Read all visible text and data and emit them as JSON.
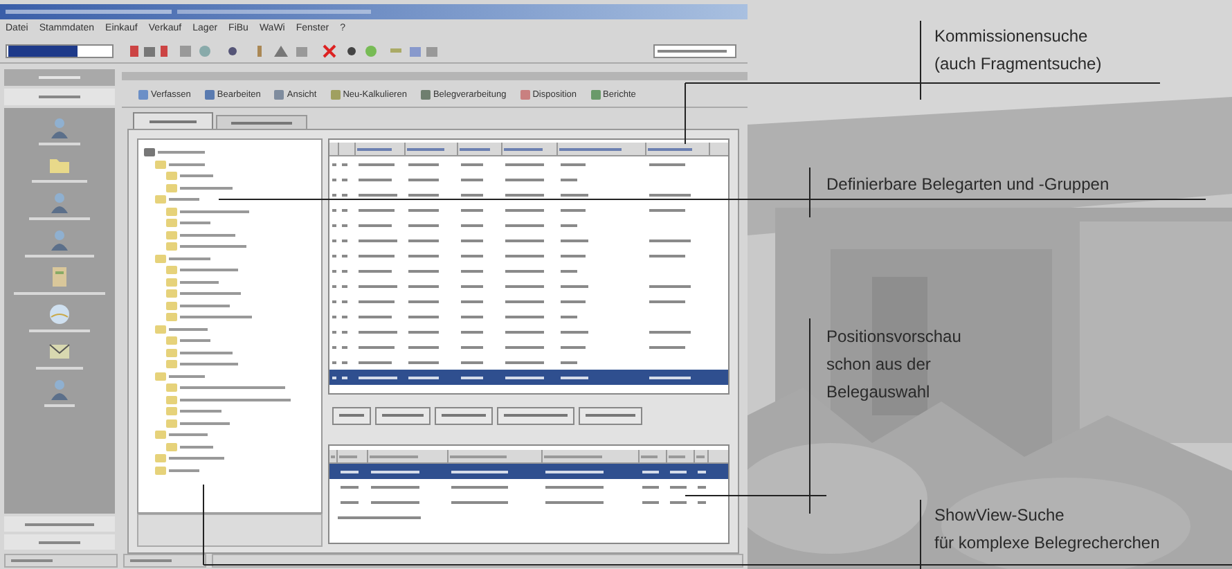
{
  "menu": [
    "Datei",
    "Stammdaten",
    "Einkauf",
    "Verkauf",
    "Lager",
    "FiBu",
    "WaWi",
    "Fenster",
    "?"
  ],
  "toolbar_buttons": [
    "Verfassen",
    "Bearbeiten",
    "Ansicht",
    "Neu-Kalkulieren",
    "Belegverarbeitung",
    "Disposition",
    "Berichte"
  ],
  "tabs": [
    {
      "selected": true
    },
    {
      "selected": false
    }
  ],
  "document_table": {
    "rows": [
      {
        "selected": false
      },
      {
        "selected": false
      },
      {
        "selected": false
      },
      {
        "selected": false
      },
      {
        "selected": false
      },
      {
        "selected": false
      },
      {
        "selected": false
      },
      {
        "selected": false
      },
      {
        "selected": false
      },
      {
        "selected": false
      },
      {
        "selected": false
      },
      {
        "selected": false
      },
      {
        "selected": false
      },
      {
        "selected": false
      },
      {
        "selected": true
      }
    ]
  },
  "position_table": {
    "rows": [
      {
        "selected": true
      },
      {
        "selected": false
      },
      {
        "selected": false
      }
    ]
  },
  "annotations": [
    {
      "lines": [
        "Kommissionensuche",
        "(auch Fragmentsuche)"
      ]
    },
    {
      "lines": [
        "Definierbare Belegarten und -Gruppen"
      ]
    },
    {
      "lines": [
        "Positionsvorschau",
        "schon aus der",
        "Belegauswahl"
      ]
    },
    {
      "lines": [
        "ShowView-Suche",
        "für komplexe Belegrecherchen"
      ]
    }
  ]
}
